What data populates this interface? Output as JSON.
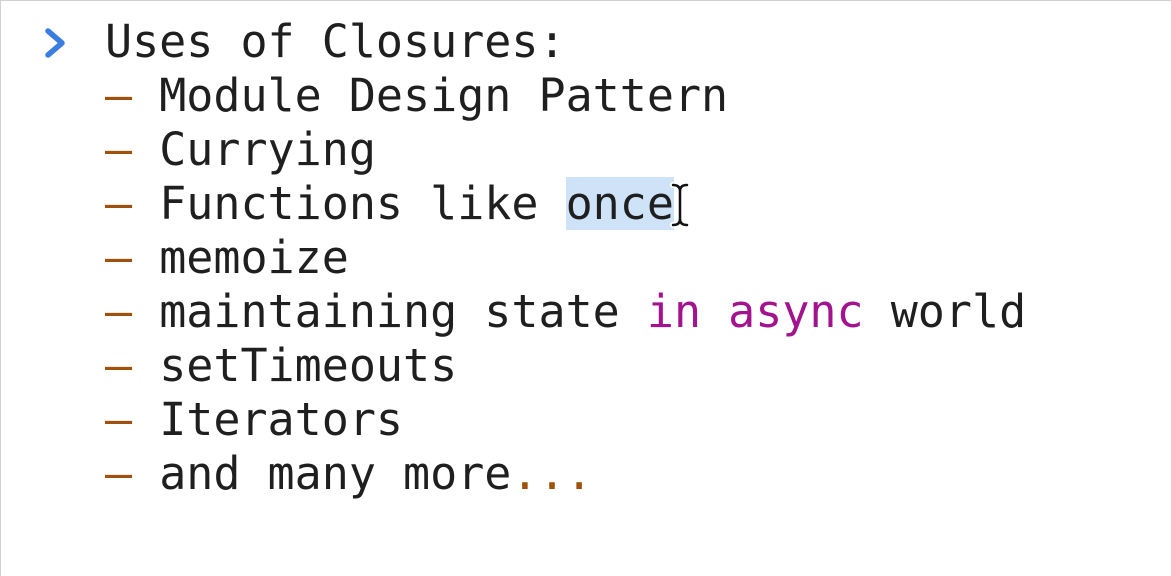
{
  "console": {
    "prompt_icon": "chevron-right-icon",
    "cursor_icon": "text-cursor-icon",
    "colors": {
      "prompt": "#3b7de0",
      "text": "#1f1f1f",
      "dash": "#a0520c",
      "keyword": "#a3128f",
      "selection": "#cfe3f8"
    },
    "heading": "Uses of Closures:",
    "items": [
      {
        "dash": "–",
        "text": "Module Design Pattern"
      },
      {
        "dash": "–",
        "text": "Currying"
      },
      {
        "dash": "–",
        "before": "Functions like ",
        "selected": "once"
      },
      {
        "dash": "–",
        "text": "memoize"
      },
      {
        "dash": "–",
        "before": "maintaining state ",
        "keyword": "in async",
        "after": " world"
      },
      {
        "dash": "–",
        "text": "setTimeouts"
      },
      {
        "dash": "–",
        "text": "Iterators"
      },
      {
        "dash": "–",
        "before": "and many more",
        "ellipsis": "..."
      }
    ]
  }
}
